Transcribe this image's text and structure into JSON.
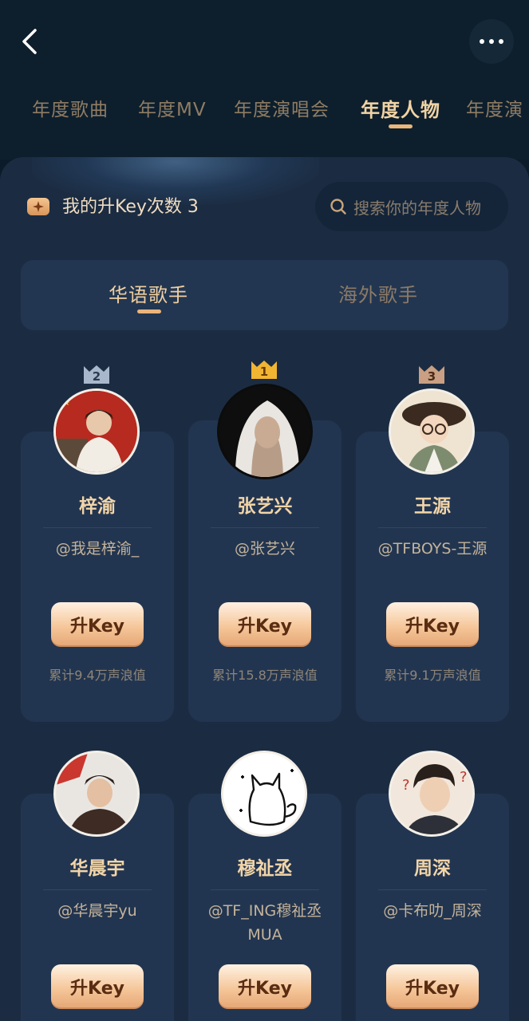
{
  "header": {
    "tabs": [
      {
        "label": "年度歌曲"
      },
      {
        "label": "年度MV"
      },
      {
        "label": "年度演唱会"
      },
      {
        "label": "年度人物"
      },
      {
        "label": "年度演"
      }
    ],
    "active_tab": "年度人物"
  },
  "key": {
    "label": "我的升Key次数 3"
  },
  "search": {
    "placeholder": "搜索你的年度人物"
  },
  "segments": {
    "a": "华语歌手",
    "b": "海外歌手",
    "active": "华语歌手"
  },
  "cards": [
    {
      "rank": "2",
      "name": "梓渝",
      "handle": "@我是梓渝_",
      "button": "升Key",
      "stat": "累计9.4万声浪值",
      "badge_color": "#a9b7cc"
    },
    {
      "rank": "1",
      "name": "张艺兴",
      "handle": "@张艺兴",
      "button": "升Key",
      "stat": "累计15.8万声浪值",
      "badge_color": "#f2b531"
    },
    {
      "rank": "3",
      "name": "王源",
      "handle": "@TFBOYS-王源",
      "button": "升Key",
      "stat": "累计9.1万声浪值",
      "badge_color": "#c9a083"
    },
    {
      "name": "华晨宇",
      "handle": "@华晨宇yu",
      "button": "升Key"
    },
    {
      "name": "穆祉丞",
      "handle": "@TF_ING穆祉丞MUA",
      "button": "升Key"
    },
    {
      "name": "周深",
      "handle": "@卡布叻_周深",
      "button": "升Key"
    }
  ],
  "colors": {
    "accent": "#eab57b",
    "card_bg": "#223550",
    "panel_bg": "#1b2c42"
  },
  "icons": [
    "back-icon",
    "more-icon",
    "key-ticket-icon",
    "search-icon",
    "crown-icon"
  ]
}
